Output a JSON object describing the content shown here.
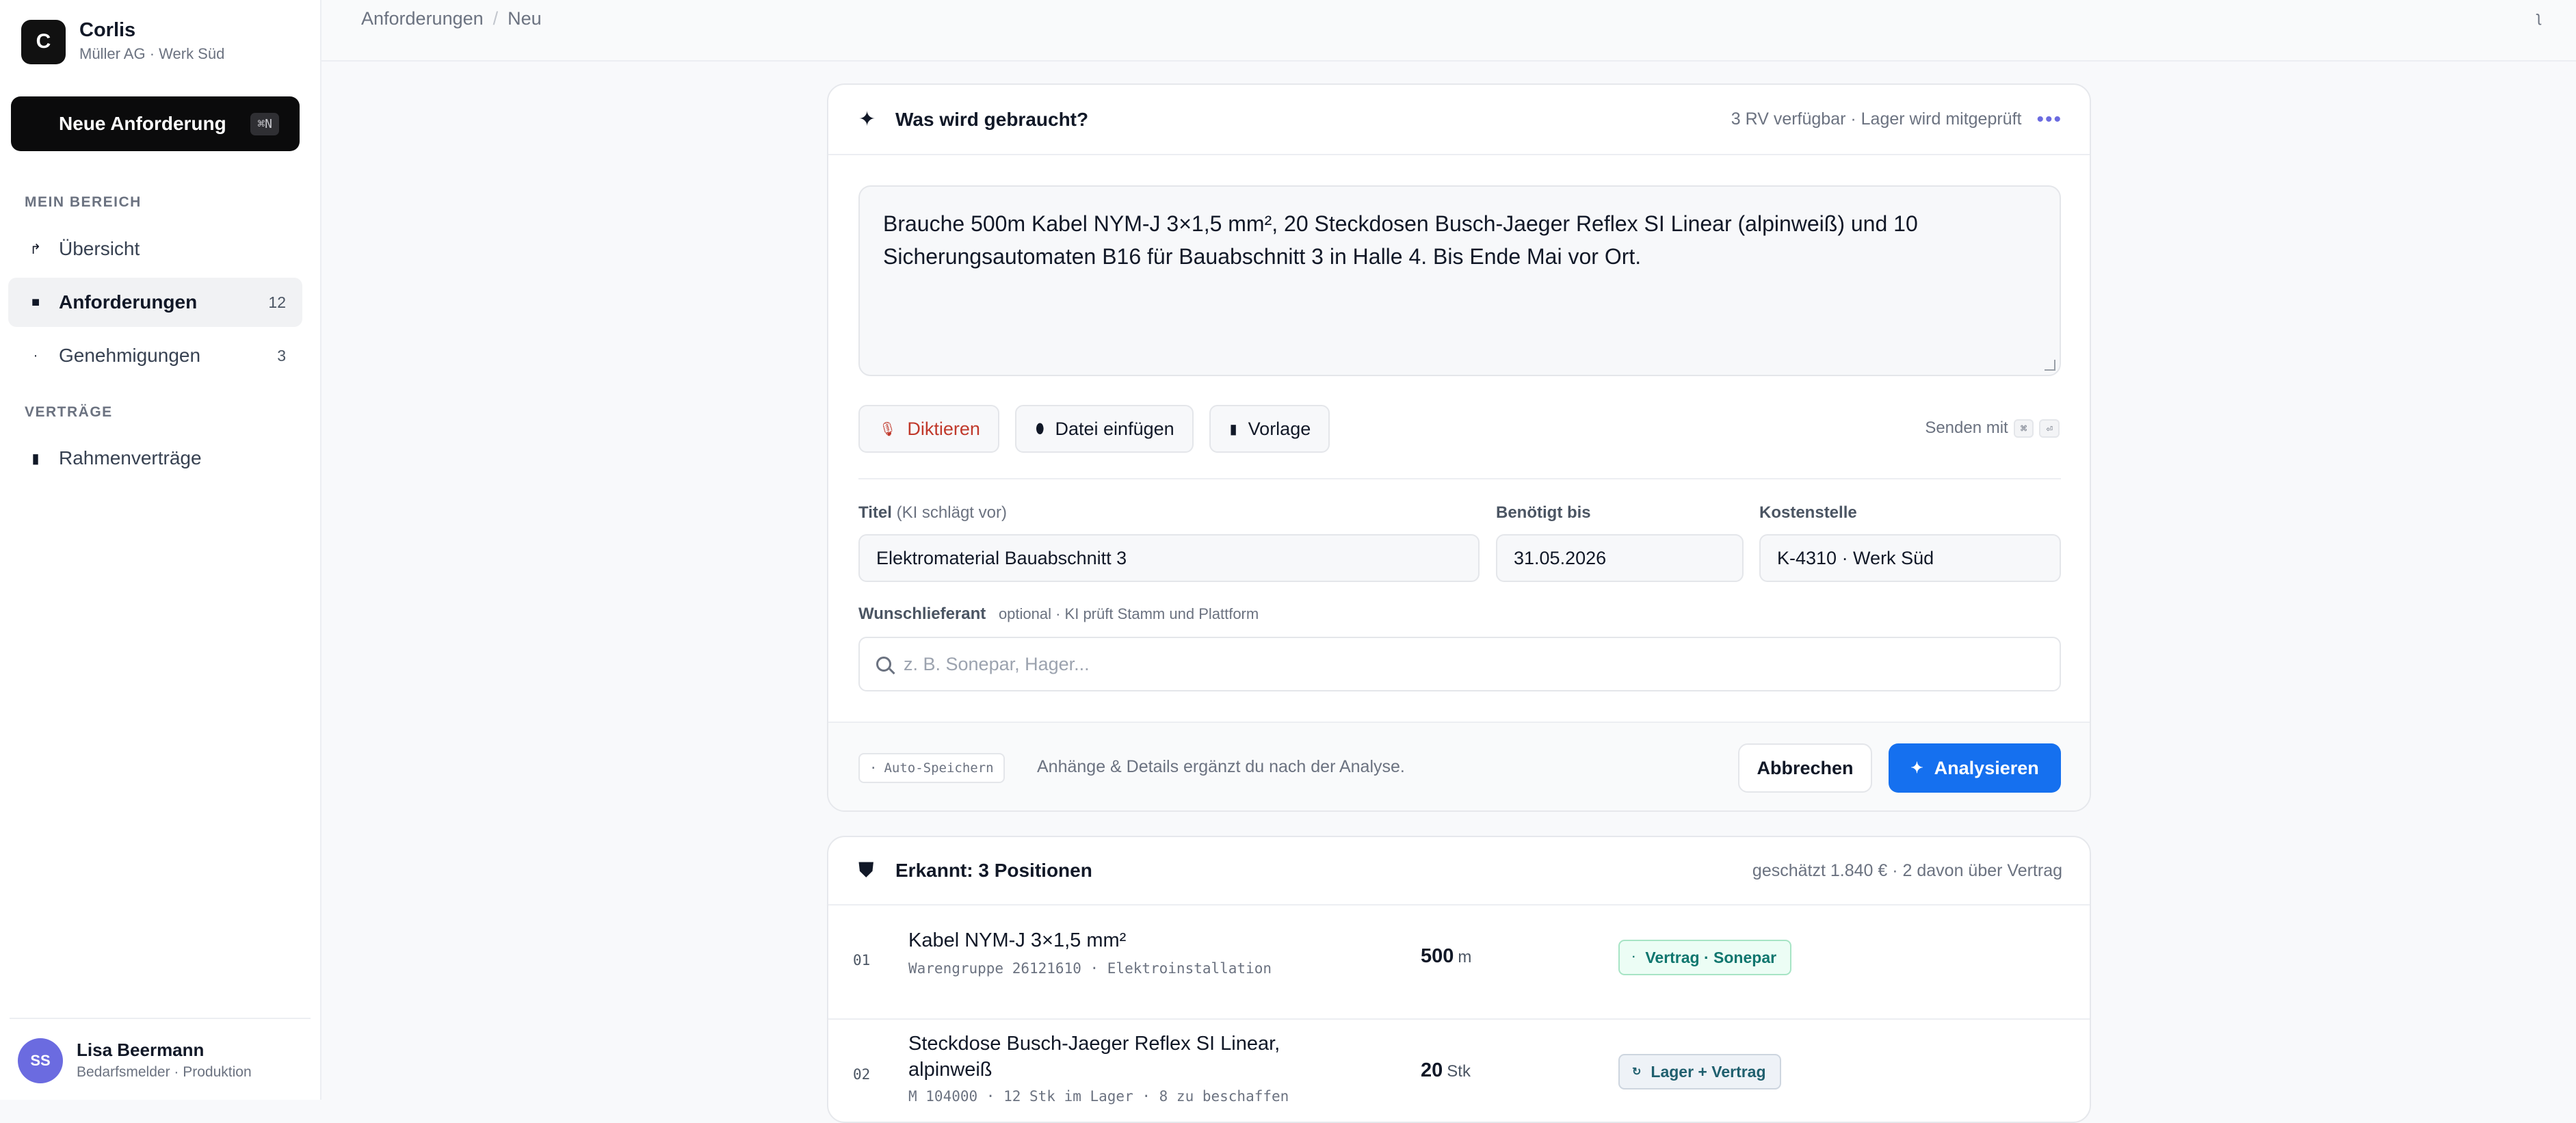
{
  "sidebar": {
    "brand_initial": "C",
    "brand_name": "Corlis",
    "brand_sub": "Müller AG · Werk Süd",
    "new_request_label": "Neue Anforderung",
    "new_request_shortcut": "⌘N",
    "section_my_area": "MEIN BEREICH",
    "section_contracts": "VERTRÄGE",
    "items": [
      {
        "label": "Übersicht",
        "count": "",
        "icon": "overview-icon"
      },
      {
        "label": "Anforderungen",
        "count": "12",
        "icon": "requests-icon"
      },
      {
        "label": "Genehmigungen",
        "count": "3",
        "icon": "approvals-icon"
      },
      {
        "label": "Rahmenverträge",
        "count": "",
        "icon": "contracts-icon"
      }
    ],
    "user": {
      "initials": "SS",
      "name": "Lisa Beermann",
      "role": "Bedarfsmelder · Produktion"
    }
  },
  "topbar": {
    "crumbs": [
      "Anforderungen",
      "Neu"
    ],
    "separator": "/",
    "right_icon_glyph": "ʅ"
  },
  "form": {
    "title": "Was wird gebraucht?",
    "status": "3 RV verfügbar · Lager wird mitgeprüft",
    "prompt_text": "Brauche 500m Kabel NYM-J 3×1,5 mm², 20 Steckdosen Busch-Jaeger Reflex SI Linear (alpinweiß) und 10 Sicherungsautomaten B16 für Bauabschnitt 3 in Halle 4. Bis Ende Mai vor Ort.",
    "tools": {
      "dictate": "Diktieren",
      "attach": "Datei einfügen",
      "template": "Vorlage"
    },
    "send_hint": "Senden mit",
    "send_keys": [
      "⌘",
      "⏎"
    ],
    "fields": {
      "title_label": "Titel",
      "title_hint": "(KI schlägt vor)",
      "title_value": "Elektromaterial Bauabschnitt 3",
      "due_label": "Benötigt bis",
      "due_value": "31.05.2026",
      "cost_label": "Kostenstelle",
      "cost_value": "K-4310 · Werk Süd",
      "supplier_label": "Wunschlieferant",
      "supplier_hint": "optional · KI prüft Stamm und Plattform",
      "supplier_placeholder": "z. B. Sonepar, Hager..."
    },
    "autosave": "Auto-Speichern",
    "footer_note": "Anhänge & Details ergänzt du nach der Analyse.",
    "cancel_label": "Abbrechen",
    "analyze_label": "Analysieren"
  },
  "results": {
    "title": "Erkannt: 3 Positionen",
    "summary": "geschätzt 1.840 € · 2 davon über Vertrag",
    "rows": [
      {
        "num": "01",
        "name": "Kabel NYM-J 3×1,5 mm²",
        "sub": "Warengruppe 26121610 · Elektroinstallation",
        "qty": "500",
        "unit": "m",
        "badge": "Vertrag · Sonepar"
      },
      {
        "num": "02",
        "name": "Steckdose Busch-Jaeger Reflex SI Linear,",
        "name2": "alpinweiß",
        "sub": "M 104000 · 12 Stk im Lager · 8 zu beschaffen",
        "qty": "20",
        "unit": "Stk",
        "badge": "Lager + Vertrag"
      }
    ]
  },
  "colors": {
    "accent": "#1570ef",
    "dots": "#6b6be0",
    "avatar": "#6b6be0",
    "dictate": "#c0392b",
    "badge_green_text": "#0f766e"
  }
}
